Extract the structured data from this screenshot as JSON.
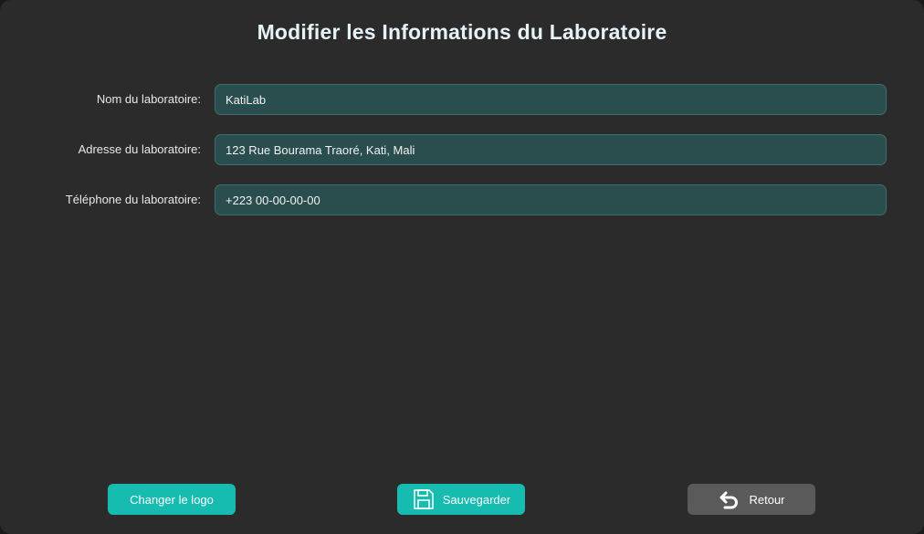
{
  "window": {
    "title": "Modifier les Informations du Laboratoire"
  },
  "form": {
    "fields": [
      {
        "label": "Nom du laboratoire:",
        "value": "KatiLab"
      },
      {
        "label": "Adresse du laboratoire:",
        "value": "123 Rue Bourama Traoré, Kati, Mali"
      },
      {
        "label": "Téléphone du laboratoire:",
        "value": "+223 00-00-00-00"
      }
    ]
  },
  "actions": {
    "change_logo_label": "Changer le logo",
    "save_label": "Sauvegarder",
    "save_icon": "floppy-disk-icon",
    "back_label": "Retour",
    "back_icon": "undo-arrow-icon"
  },
  "colors": {
    "background": "#2b2b2b",
    "input_bg": "#2a4d4d",
    "accent": "#17bcb0",
    "secondary_button": "#5a5a5a"
  }
}
